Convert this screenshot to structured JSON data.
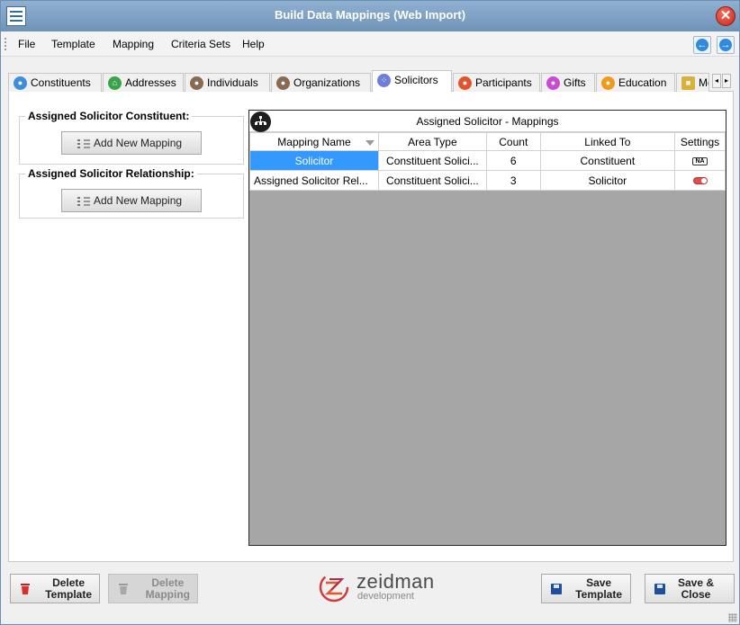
{
  "window": {
    "title": "Build Data Mappings (Web Import)"
  },
  "menu": {
    "items": [
      "File",
      "Template",
      "Mapping",
      "Criteria Sets",
      "Help"
    ]
  },
  "tabs": [
    {
      "label": "Constituents",
      "icon": "people-icon",
      "color": "#3d8fd9"
    },
    {
      "label": "Addresses",
      "icon": "home-icon",
      "color": "#3aa34a"
    },
    {
      "label": "Individuals",
      "icon": "person-icon",
      "color": "#8a6a52"
    },
    {
      "label": "Organizations",
      "icon": "org-icon",
      "color": "#8a6a52"
    },
    {
      "label": "Solicitors",
      "icon": "hierarchy-icon",
      "color": "#6f7fd6",
      "active": true
    },
    {
      "label": "Participants",
      "icon": "crowd-icon",
      "color": "#e0552e"
    },
    {
      "label": "Gifts",
      "icon": "gift-icon",
      "color": "#c84bd4"
    },
    {
      "label": "Education",
      "icon": "education-icon",
      "color": "#f09a1c"
    },
    {
      "label": "Me",
      "icon": "lock-icon",
      "color": "#d8b13a"
    }
  ],
  "left_panel": {
    "group1": {
      "title": "Assigned Solicitor Constituent:",
      "button": "Add New Mapping"
    },
    "group2": {
      "title": "Assigned Solicitor Relationship:",
      "button": "Add New Mapping"
    }
  },
  "grid": {
    "caption": "Assigned Solicitor - Mappings",
    "columns": [
      "Mapping Name",
      "Area Type",
      "Count",
      "Linked To",
      "Settings"
    ],
    "rows": [
      {
        "mapping_name": "Solicitor",
        "area_type": "Constituent Solici...",
        "count": "6",
        "linked_to": "Constituent",
        "settings": "NA"
      },
      {
        "mapping_name": "Assigned Solicitor Rel...",
        "area_type": "Constituent Solici...",
        "count": "3",
        "linked_to": "Solicitor",
        "settings": "toggle-on"
      }
    ]
  },
  "bottom": {
    "delete_template": [
      "Delete",
      "Template"
    ],
    "delete_mapping": [
      "Delete",
      "Mapping"
    ],
    "save_template": [
      "Save",
      "Template"
    ],
    "save_close": [
      "Save &",
      "Close"
    ],
    "logo_name": "zeidman",
    "logo_sub": "development"
  }
}
